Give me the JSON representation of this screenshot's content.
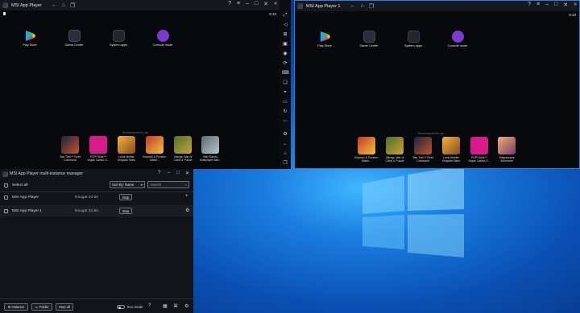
{
  "colors": {
    "accent": "#2f7de1",
    "window_bg": "#0e1016",
    "desktop": "#0a4fb3"
  },
  "window_left": {
    "title": "MSI App Player",
    "clock": "9:10",
    "apps": [
      {
        "label": "Play Store",
        "icon": "play-store-icon"
      },
      {
        "label": "Game Center",
        "icon": "game-center-icon"
      },
      {
        "label": "System apps",
        "icon": "system-apps-icon"
      },
      {
        "label": "Console mode",
        "icon": "console-mode-icon"
      }
    ],
    "recommended": "Recommended for you",
    "games": [
      {
        "label": "Star Trek™ Fleet Command"
      },
      {
        "label": "POP! Slots™ Vegas Casino G..."
      },
      {
        "label": "Lords Mobile: Kingdom Wars"
      },
      {
        "label": "Empires & Puzzles: Match..."
      },
      {
        "label": "Vikings: War of Clans & Puzzle"
      },
      {
        "label": "War Robots Multiplayer Batt..."
      }
    ]
  },
  "window_right": {
    "title": "MSI App Player 1",
    "clock": "9:10",
    "apps": [
      {
        "label": "Play Store"
      },
      {
        "label": "Game Center"
      },
      {
        "label": "System apps"
      },
      {
        "label": "Console mode"
      }
    ],
    "recommended": "Recommended for you",
    "games": [
      {
        "label": "Empires & Puzzles: Match..."
      },
      {
        "label": "Vikings: War of Clans & Puzzle"
      },
      {
        "label": "Star Trek™ Fleet Command"
      },
      {
        "label": "Lords Mobile: Kingdom Wars"
      },
      {
        "label": "POP! Slots™ Vegas Casino G..."
      },
      {
        "label": "Disgracepes Adventure"
      }
    ]
  },
  "manager": {
    "title": "MSI App Player multi-instance manager",
    "select_all": "Select all",
    "sort_by": "Sort By: Name",
    "search_placeholder": "Search",
    "instances": [
      {
        "name": "MSI App Player",
        "version": "Nougat 32-bit",
        "action": "Stop"
      },
      {
        "name": "MSI App Player 1",
        "version": "Nougat 32-bit",
        "action": "Stop"
      }
    ],
    "footer": {
      "instance": "Instance",
      "folder": "Folder",
      "stop_all": "Stop all",
      "eco_mode": "Eco mode"
    }
  }
}
